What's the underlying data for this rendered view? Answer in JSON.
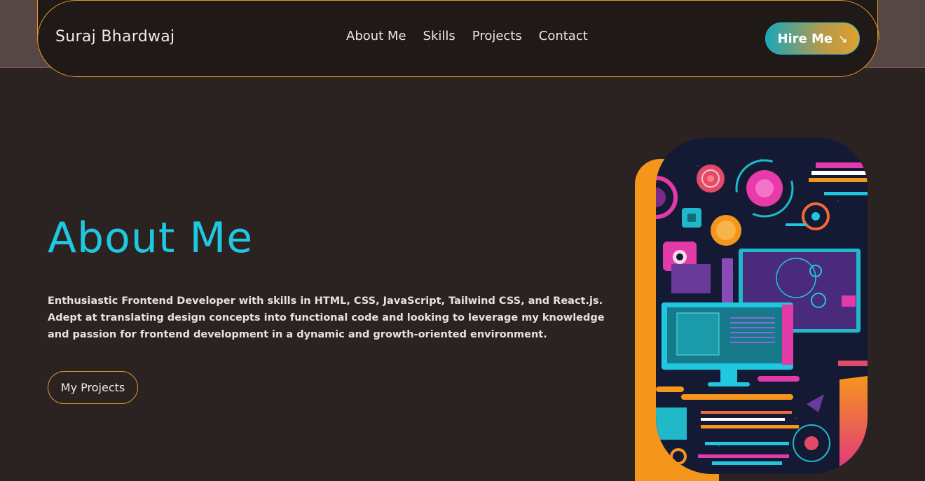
{
  "nav": {
    "brand": "Suraj Bhardwaj",
    "links": [
      "About Me",
      "Skills",
      "Projects",
      "Contact"
    ],
    "hire_label": "Hire Me",
    "hire_icon": "arrow-down-right-icon"
  },
  "hero": {
    "title": "About Me",
    "description": "Enthusiastic Frontend Developer with skills in HTML, CSS, JavaScript, Tailwind CSS, and React.js. Adept at translating design concepts into functional code and looking to leverage my knowledge and passion for frontend development in a dynamic and growth-oriented environment.",
    "cta_label": "My Projects"
  },
  "colors": {
    "accent_cyan": "#1fc7e0",
    "accent_orange": "#e3962a",
    "background": "#2b2322",
    "nav_background": "#1f1917"
  }
}
